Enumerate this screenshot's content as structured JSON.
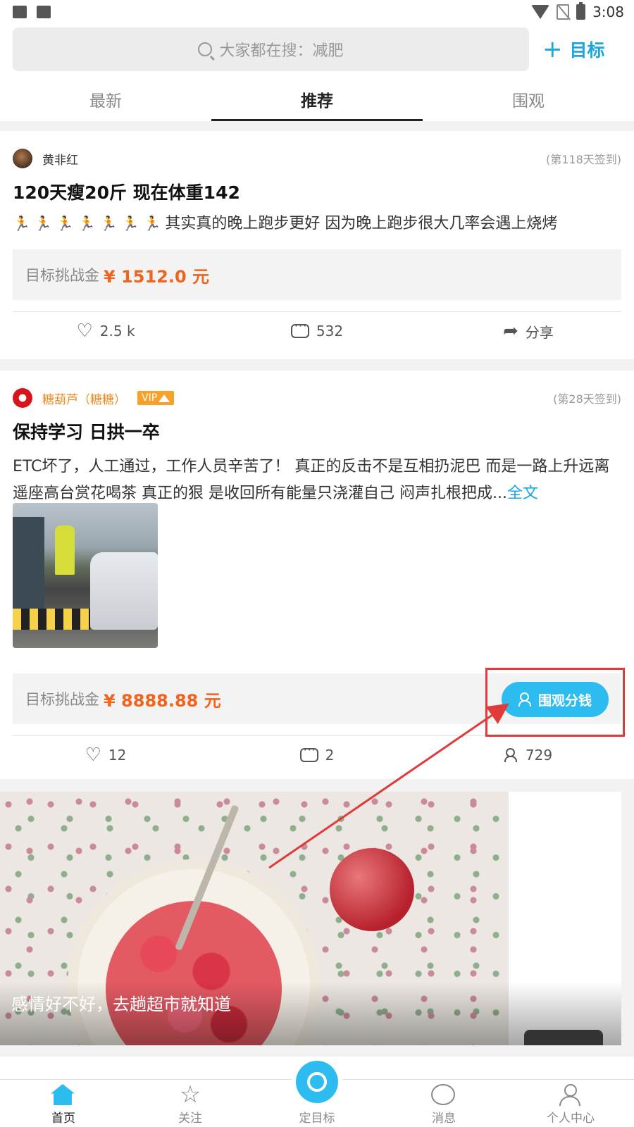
{
  "status_bar": {
    "time": "3:08"
  },
  "search": {
    "placeholder": "大家都在搜：减肥"
  },
  "header": {
    "add_goal_plus": "+",
    "add_goal_label": "目标"
  },
  "tabs": [
    {
      "label": "最新",
      "active": false
    },
    {
      "label": "推荐",
      "active": true
    },
    {
      "label": "围观",
      "active": false
    }
  ],
  "posts": [
    {
      "user": "黄非红",
      "checkin": "(第118天签到)",
      "title": "120天瘦20斤  现在体重142",
      "body": "其实真的晚上跑步更好 因为晚上跑步很大几率会遇上烧烤",
      "runner_icon": "🏃",
      "prize_label": "目标挑战金",
      "prize_amount": "¥  1512.0 元",
      "likes": "2.5 k",
      "comments": "532",
      "share_label": "分享"
    },
    {
      "user": "糖葫芦（糖糖）",
      "vip_label": "VIP",
      "checkin": "(第28天签到)",
      "title": "保持学习 日拱一卒",
      "body": "ETC坏了，人工通过，工作人员辛苦了！ 真正的反击不是互相扔泥巴 而是一路上升远离 遥座高台赏花喝茶 真正的狠 是收回所有能量只浇灌自己 闷声扎根把成...",
      "fulltext_link": "全文",
      "prize_label": "目标挑战金",
      "prize_amount": "¥  8888.88 元",
      "watch_button": "围观分钱",
      "likes": "12",
      "comments": "2",
      "watchers": "729"
    }
  ],
  "banner": {
    "caption": "感情好不好，去趟超市就知道"
  },
  "bottom_nav": [
    {
      "label": "首页",
      "icon": "home-icon",
      "active": true
    },
    {
      "label": "关注",
      "icon": "star-icon",
      "active": false
    },
    {
      "label": "定目标",
      "icon": "target-icon",
      "active": false
    },
    {
      "label": "消息",
      "icon": "message-icon",
      "active": false
    },
    {
      "label": "个人中心",
      "icon": "user-icon",
      "active": false
    }
  ],
  "colors": {
    "accent": "#2cbcf0",
    "prize": "#f0641e",
    "highlight": "#e03a3a"
  }
}
